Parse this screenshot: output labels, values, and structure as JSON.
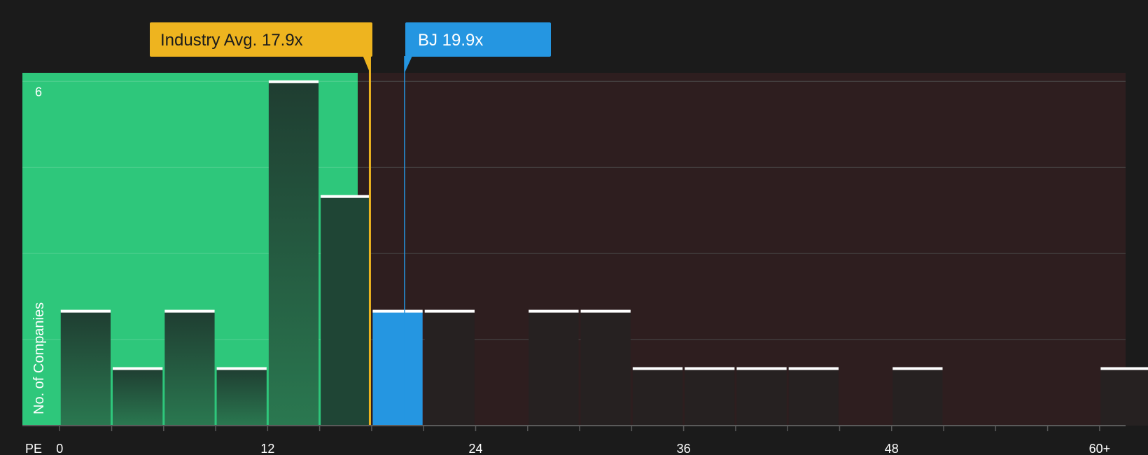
{
  "chart_data": {
    "type": "bar",
    "title": "",
    "xlabel": "PE",
    "ylabel": "No. of Companies",
    "x_tick_labels": [
      "0",
      "12",
      "24",
      "36",
      "48",
      "60+"
    ],
    "x_tick_values": [
      0,
      12,
      24,
      36,
      48,
      60
    ],
    "bin_width": 3,
    "xlim": [
      -2.15,
      61.5
    ],
    "ylim": [
      0,
      6.15
    ],
    "y_tick_labels": [
      "6"
    ],
    "y_gridlines": [
      1.5,
      3,
      4.5,
      6
    ],
    "bins": [
      {
        "start": 0,
        "end": 3,
        "count": 2
      },
      {
        "start": 3,
        "end": 6,
        "count": 1
      },
      {
        "start": 6,
        "end": 9,
        "count": 2
      },
      {
        "start": 9,
        "end": 12,
        "count": 1
      },
      {
        "start": 12,
        "end": 15,
        "count": 6
      },
      {
        "start": 15,
        "end": 18,
        "count": 4
      },
      {
        "start": 18,
        "end": 21,
        "count": 2,
        "highlight": true
      },
      {
        "start": 21,
        "end": 24,
        "count": 2
      },
      {
        "start": 27,
        "end": 30,
        "count": 2
      },
      {
        "start": 30,
        "end": 33,
        "count": 2
      },
      {
        "start": 33,
        "end": 36,
        "count": 1
      },
      {
        "start": 36,
        "end": 39,
        "count": 1
      },
      {
        "start": 39,
        "end": 42,
        "count": 1
      },
      {
        "start": 42,
        "end": 45,
        "count": 1
      },
      {
        "start": 48,
        "end": 51,
        "count": 1
      },
      {
        "start": 60,
        "end": 63,
        "count": 1
      }
    ],
    "fair_zone_end": 17.2,
    "annotations": [
      {
        "label": "Industry Avg. 17.9x",
        "value": 17.9,
        "color": "#eeb41f",
        "text_color": "#1b1b1b"
      },
      {
        "label": "BJ 19.9x",
        "value": 19.9,
        "color": "#2596e1",
        "text_color": "#ffffff"
      }
    ],
    "colors": {
      "background": "#1b1b1b",
      "fair_zone": "#2ec77b",
      "high_zone": "#2e1e1f",
      "bar_in_fair": "#1f5f3f",
      "bar_in_high": "#262121",
      "bar_highlight": "#2596e1",
      "bar_cap": "#ffffff",
      "axis": "#5a5a5a",
      "gridline": "#4b4b4b",
      "text": "#ffffff"
    }
  }
}
